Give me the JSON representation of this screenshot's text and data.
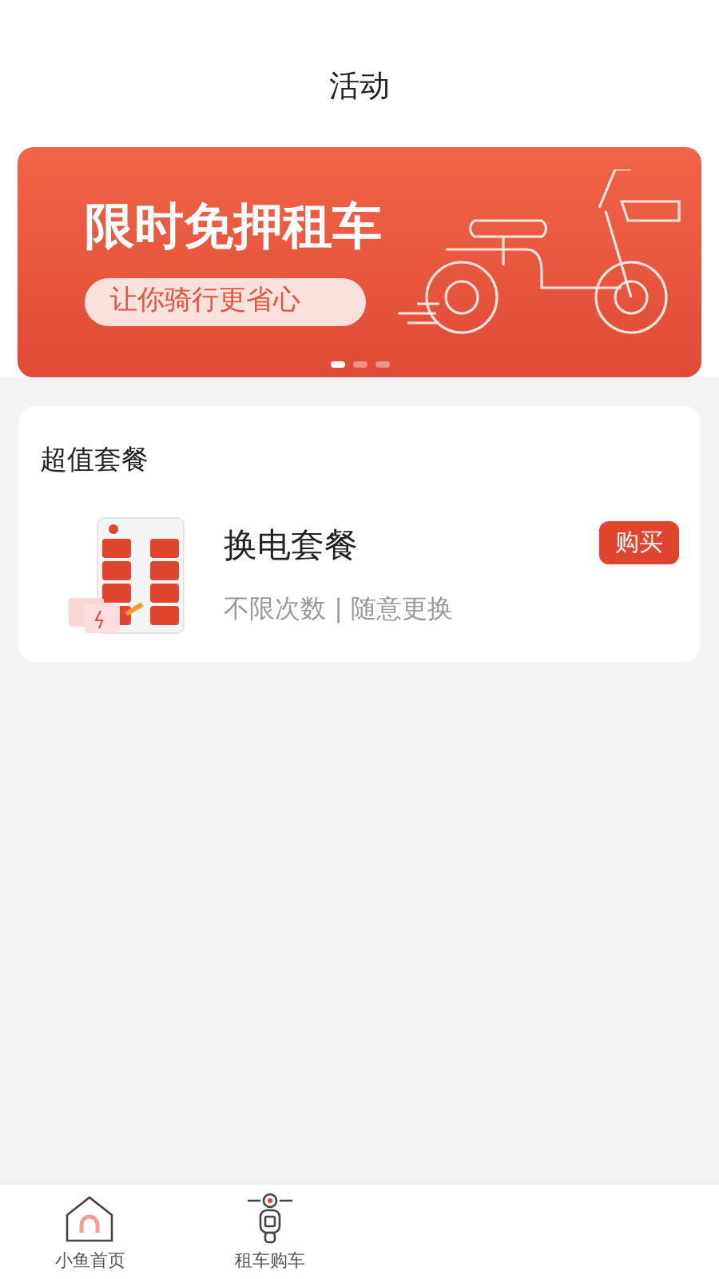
{
  "header": {
    "title": "活动"
  },
  "banner": {
    "headline": "限时免押租车",
    "tagline": "让你骑行更省心",
    "dots": [
      {
        "selected": true
      },
      {
        "selected": false
      },
      {
        "selected": false
      }
    ]
  },
  "section": {
    "title": "超值套餐",
    "packages": [
      {
        "name": "换电套餐",
        "description": "不限次数 | 随意更换",
        "action": "购买"
      }
    ]
  },
  "tab_bar": [
    {
      "label": "小鱼首页",
      "kind": "home",
      "selected": false
    },
    {
      "label": "租车购车",
      "kind": "scooter",
      "selected": false
    }
  ]
}
